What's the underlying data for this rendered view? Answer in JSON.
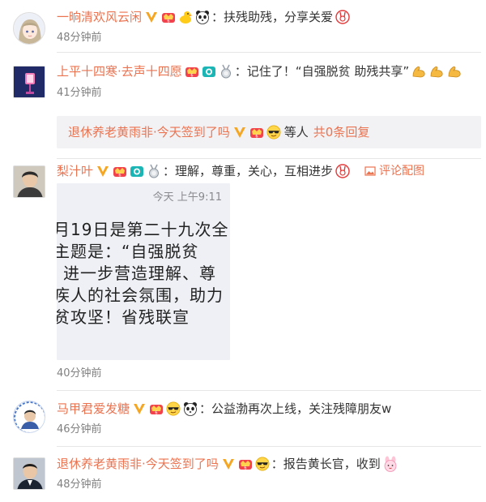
{
  "comments": [
    {
      "username": "一晌清欢风云闲",
      "text": "扶残助残，分享关爱",
      "time": "48分钟前"
    },
    {
      "username": "上平十四寒·去声十四愿",
      "text": "记住了！“自强脱贫 助残共享”",
      "time": "41分钟前",
      "reply": {
        "username": "退休养老黄雨非·今天签到了吗",
        "etc": "等人",
        "count_label": "共0条回复"
      }
    },
    {
      "username": "梨汁叶",
      "text": "理解，尊重，关心，互相进步",
      "time": "40分钟前",
      "pic_label": "评论配图",
      "image": {
        "header_time": "今天 上午9:11",
        "lines": [
          "月19日是第二十九次全",
          "主题是：“自强脱贫",
          "进一步营造理解、尊",
          "疾人的社会氛围，助力",
          "贫攻坚！省残联宣"
        ]
      }
    },
    {
      "username": "马甲君爱发糖",
      "text": "公益渤再次上线，关注残障朋友w",
      "time": "46分钟前"
    },
    {
      "username": "退休养老黄雨非·今天签到了吗",
      "text": "报告黄长官，收到",
      "time": "48分钟前"
    }
  ],
  "colors": {
    "username": "#eb7350",
    "text": "#333333",
    "time": "#808080",
    "reply_bg": "#f2f2f5"
  },
  "icons": [
    "verified-v-icon",
    "vip-crown-icon",
    "duck-icon",
    "panda-icon",
    "rabbit-icon",
    "camera-badge-icon",
    "medal-icon",
    "muscle-emoji",
    "cool-face-emoji",
    "bunny-face-emoji",
    "picture-icon"
  ]
}
